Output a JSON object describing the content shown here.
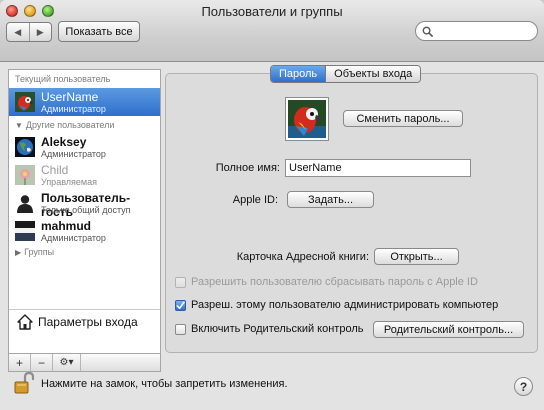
{
  "window": {
    "title": "Пользователи и группы"
  },
  "toolbar": {
    "back_icon": "◀",
    "forward_icon": "▶",
    "show_all_label": "Показать все",
    "search_placeholder": ""
  },
  "sidebar": {
    "current_user_header": "Текущий пользователь",
    "current_user": {
      "name": "UserName",
      "role": "Администратор"
    },
    "other_users_header": "Другие пользователи",
    "other_users": [
      {
        "name": "Aleksey",
        "role": "Администратор",
        "icon": "earth-icon"
      },
      {
        "name": "Child",
        "role": "Управляемая",
        "icon": "flower-icon",
        "dim": true
      },
      {
        "name": "Пользователь-гость",
        "role": "Только общий доступ",
        "icon": "silhouette-icon"
      },
      {
        "name": "mahmud",
        "role": "Администратор",
        "icon": "landscape-icon"
      }
    ],
    "groups_header": "Группы",
    "login_options_label": "Параметры входа",
    "add_icon": "+",
    "remove_icon": "−",
    "gear_icon": "⚙▾"
  },
  "tabs": [
    {
      "label": "Пароль",
      "active": true
    },
    {
      "label": "Объекты входа",
      "active": false
    }
  ],
  "main": {
    "change_password_button": "Сменить пароль...",
    "full_name_label": "Полное имя:",
    "full_name_value": "UserName",
    "apple_id_label": "Apple ID:",
    "apple_id_button": "Задать...",
    "address_card_label": "Карточка Адресной книги:",
    "address_card_button": "Открыть...",
    "allow_reset_label": "Разрешить пользователю сбрасывать пароль с Apple ID",
    "allow_reset_checked": false,
    "admin_label": "Разреш. этому пользователю администрировать компьютер",
    "admin_checked": true,
    "parental_label": "Включить Родительский контроль",
    "parental_checked": false,
    "parental_button": "Родительский контроль..."
  },
  "footer": {
    "lock_text": "Нажмите на замок, чтобы запретить изменения.",
    "help_label": "?"
  },
  "colors": {
    "selection": "#2f6fcc",
    "window_bg": "#e3e3e3"
  }
}
